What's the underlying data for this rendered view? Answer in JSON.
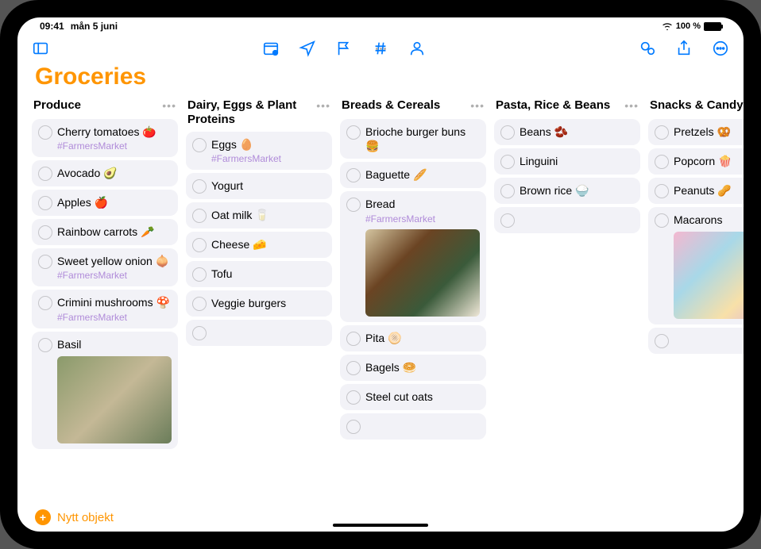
{
  "status": {
    "time": "09:41",
    "date": "mån 5 juni",
    "battery_text": "100 %"
  },
  "list": {
    "title": "Groceries"
  },
  "columns": [
    {
      "title": "Produce",
      "items": [
        {
          "text": "Cherry tomatoes 🍅",
          "tag": "#FarmersMarket"
        },
        {
          "text": "Avocado 🥑"
        },
        {
          "text": "Apples 🍎"
        },
        {
          "text": "Rainbow carrots 🥕"
        },
        {
          "text": "Sweet yellow onion 🧅",
          "tag": "#FarmersMarket"
        },
        {
          "text": "Crimini mushrooms 🍄",
          "tag": "#FarmersMarket"
        },
        {
          "text": "Basil",
          "image": "basil"
        }
      ]
    },
    {
      "title": "Dairy, Eggs & Plant Proteins",
      "items": [
        {
          "text": "Eggs 🥚",
          "tag": "#FarmersMarket"
        },
        {
          "text": "Yogurt"
        },
        {
          "text": "Oat milk 🥛"
        },
        {
          "text": "Cheese 🧀"
        },
        {
          "text": "Tofu"
        },
        {
          "text": "Veggie burgers"
        },
        {
          "empty": true
        }
      ]
    },
    {
      "title": "Breads & Cereals",
      "items": [
        {
          "text": "Brioche burger buns 🍔"
        },
        {
          "text": "Baguette 🥖"
        },
        {
          "text": "Bread",
          "tag": "#FarmersMarket",
          "image": "bread"
        },
        {
          "text": "Pita 🫓"
        },
        {
          "text": "Bagels 🥯"
        },
        {
          "text": "Steel cut oats"
        },
        {
          "empty": true
        }
      ]
    },
    {
      "title": "Pasta, Rice & Beans",
      "items": [
        {
          "text": "Beans 🫘"
        },
        {
          "text": "Linguini"
        },
        {
          "text": "Brown rice 🍚"
        },
        {
          "empty": true
        }
      ]
    },
    {
      "title": "Snacks & Candy",
      "cutoff": true,
      "items": [
        {
          "text": "Pretzels 🥨"
        },
        {
          "text": "Popcorn 🍿"
        },
        {
          "text": "Peanuts 🥜"
        },
        {
          "text": "Macarons",
          "image": "macaron"
        },
        {
          "empty": true
        }
      ]
    }
  ],
  "footer": {
    "new_item": "Nytt objekt"
  }
}
